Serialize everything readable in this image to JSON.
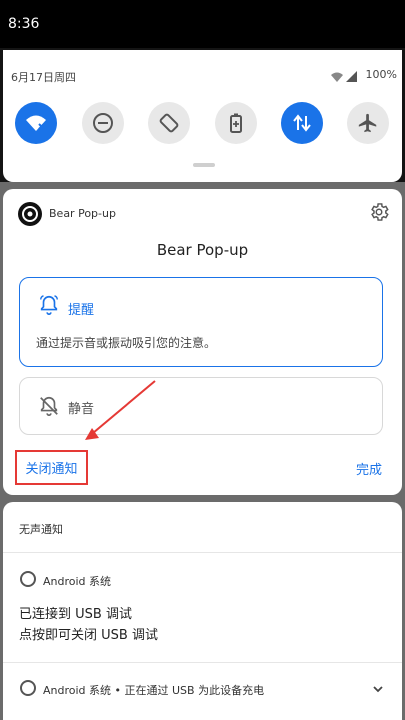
{
  "status_bar": {
    "time": "8:36"
  },
  "quick_settings": {
    "date": "6月17日周四",
    "battery": "100%",
    "tiles": [
      {
        "name": "wifi",
        "state": "on"
      },
      {
        "name": "do-not-disturb",
        "state": "off"
      },
      {
        "name": "auto-rotate",
        "state": "off"
      },
      {
        "name": "battery-saver",
        "state": "off"
      },
      {
        "name": "mobile-data",
        "state": "on"
      },
      {
        "name": "airplane-mode",
        "state": "off"
      }
    ]
  },
  "notification_settings": {
    "app_name": "Bear Pop-up",
    "title": "Bear Pop-up",
    "alert_option": {
      "label": "提醒",
      "description": "通过提示音或振动吸引您的注意。"
    },
    "silent_option": {
      "label": "静音"
    },
    "close_label": "关闭通知",
    "done_label": "完成"
  },
  "silent_section": {
    "header": "无声通知",
    "notifications": [
      {
        "app": "Android 系统",
        "line1": "已连接到 USB 调试",
        "line2": "点按即可关闭 USB 调试"
      },
      {
        "summary": "Android 系统 • 正在通过 USB 为此设备充电"
      }
    ]
  },
  "colors": {
    "accent": "#1a73e8",
    "highlight": "#e53935"
  }
}
